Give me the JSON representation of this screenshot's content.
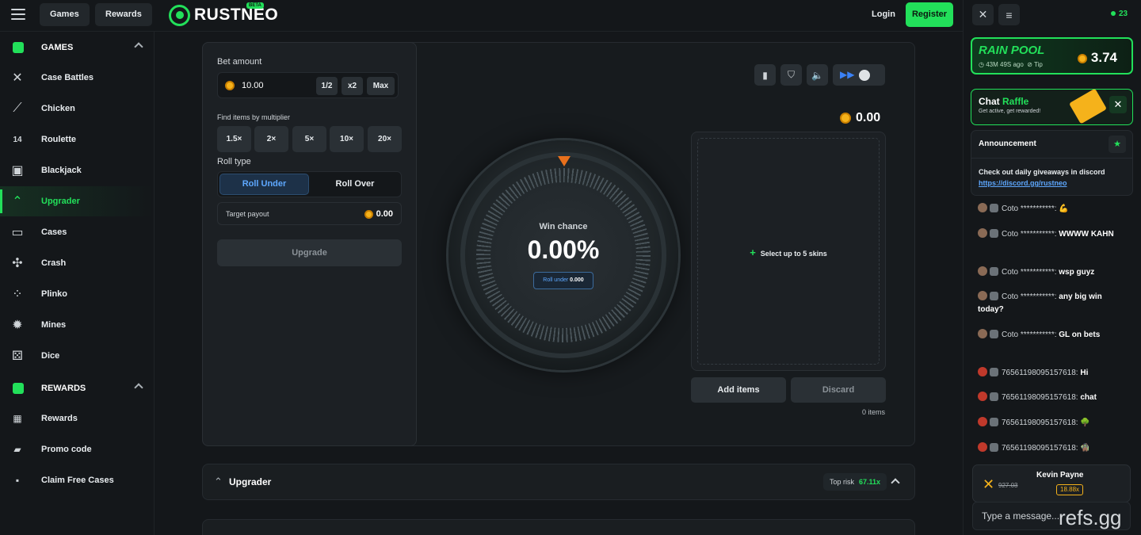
{
  "topbar": {
    "games_label": "Games",
    "rewards_label": "Rewards",
    "logo_text": "RUSTNEO",
    "beta_label": "BETA",
    "login_label": "Login",
    "register_label": "Register"
  },
  "sidebar": {
    "games_header": "GAMES",
    "rewards_header": "REWARDS",
    "games": [
      {
        "label": "Case Battles",
        "icon": "swords-icon"
      },
      {
        "label": "Chicken",
        "icon": "feather-icon"
      },
      {
        "label": "Roulette",
        "icon": "roulette-icon"
      },
      {
        "label": "Blackjack",
        "icon": "cards-icon"
      },
      {
        "label": "Upgrader",
        "icon": "upgrade-chevrons-icon"
      },
      {
        "label": "Cases",
        "icon": "chest-icon"
      },
      {
        "label": "Crash",
        "icon": "crash-icon"
      },
      {
        "label": "Plinko",
        "icon": "plinko-icon"
      },
      {
        "label": "Mines",
        "icon": "mines-icon"
      },
      {
        "label": "Dice",
        "icon": "dice-icon"
      }
    ],
    "rewards": [
      {
        "label": "Rewards",
        "icon": "calendar-icon"
      },
      {
        "label": "Promo code",
        "icon": "ticket-icon"
      },
      {
        "label": "Claim Free Cases",
        "icon": "box-icon"
      }
    ]
  },
  "upgrader": {
    "bet_amount_label": "Bet amount",
    "bet_value": "10.00",
    "half_label": "1/2",
    "double_label": "x2",
    "max_label": "Max",
    "find_label": "Find items by multiplier",
    "multipliers": [
      "1.5×",
      "2×",
      "5×",
      "10×",
      "20×"
    ],
    "roll_type_label": "Roll type",
    "roll_under_label": "Roll Under",
    "roll_over_label": "Roll Over",
    "target_payout_label": "Target payout",
    "target_payout_value": "0.00",
    "upgrade_label": "Upgrade",
    "win_chance_label": "Win chance",
    "win_chance_value": "0.00%",
    "roll_under_pill_label": "Roll under",
    "roll_under_pill_value": "0.000",
    "balance": "0.00",
    "select_skins_label": "Select up to 5 skins",
    "add_items_label": "Add items",
    "discard_label": "Discard",
    "items_count": "0 items",
    "section_title": "Upgrader",
    "top_risk_label": "Top risk",
    "top_risk_value": "67.11x"
  },
  "chat": {
    "online_count": "23",
    "rain_title": "RAIN POOL",
    "rain_timer": "43M 49S ago",
    "rain_tip": "Tip",
    "rain_amount": "3.74",
    "raffle_title_a": "Chat",
    "raffle_title_b": "Raffle",
    "raffle_sub": "Get active, get rewarded!",
    "announcement_title": "Announcement",
    "announcement_text": "Check out daily giveaways in discord",
    "announcement_link": "https://discord.gg/rustneo",
    "messages": [
      {
        "user": "Coto ***********:",
        "text": "💪"
      },
      {
        "user": "Coto ***********:",
        "text": "WWWW KAHN"
      },
      {
        "user": "Coto ***********:",
        "text": "wsp guyz"
      },
      {
        "user": "Coto ***********:",
        "text": "any big win today?"
      },
      {
        "user": "Coto ***********:",
        "text": "GL on bets"
      },
      {
        "user": "76561198095157618:",
        "text": "Hi"
      },
      {
        "user": "76561198095157618:",
        "text": "chat"
      },
      {
        "user": "76561198095157618:",
        "text": "🌳"
      },
      {
        "user": "76561198095157618:",
        "text": "🧌"
      }
    ],
    "drop_user": "Kevin Payne",
    "drop_old_value": "927.03",
    "drop_multiplier": "18.88x",
    "input_placeholder": "Type a message...",
    "watermark": "refs.gg"
  },
  "colors": {
    "accent": "#22e05a",
    "background": "#14171a",
    "panel": "#1c2024",
    "roll_under_blue": "#5ea8ff",
    "coin": "#f5b21b",
    "pointer": "#e8701c"
  }
}
